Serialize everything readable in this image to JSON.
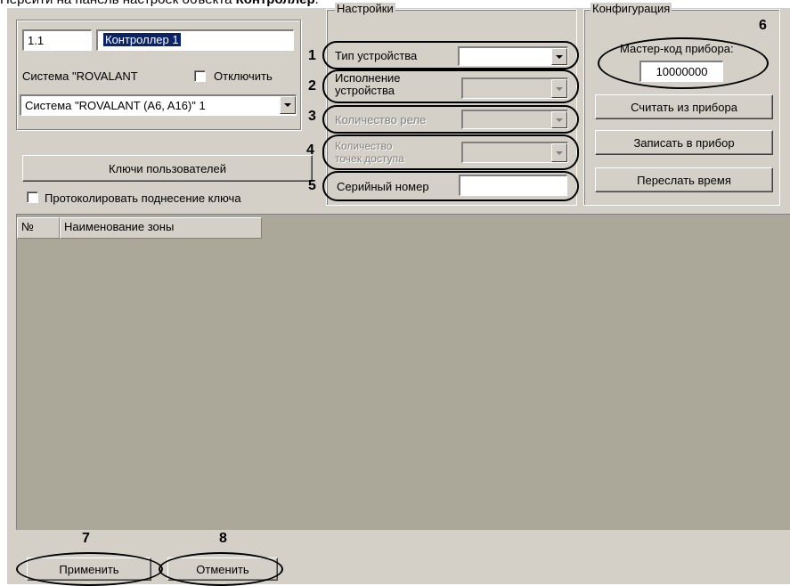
{
  "caption": {
    "prefix": "Перейти на панель настроек объекта ",
    "bold": "Контроллер",
    "suffix": "."
  },
  "object": {
    "id_value": "1.1",
    "name_value": "Контроллер 1",
    "system_label": "Система \"ROVALANT",
    "disable_label": "Отключить",
    "system_select": "Система \"ROVALANT (A6, A16)\" 1"
  },
  "buttons": {
    "user_keys": "Ключи пользователей",
    "read_from_device": "Считать из прибора",
    "write_to_device": "Записать в прибор",
    "send_time": "Переслать время",
    "apply": "Применить",
    "cancel": "Отменить"
  },
  "log_checkbox_label": "Протоколировать поднесение ключа",
  "settings": {
    "title": "Настройки",
    "device_type": "Тип устройства",
    "device_version_line1": "Исполнение",
    "device_version_line2": "устройства",
    "relay_count": "Количество реле",
    "access_points_line1": "Количество",
    "access_points_line2": "точек доступа",
    "serial_number": "Серийный номер"
  },
  "configuration": {
    "title": "Конфигурация",
    "master_code_label": "Мастер-код прибора:",
    "master_code_value": "10000000"
  },
  "table": {
    "columns": [
      "№",
      "Наименование зоны"
    ]
  },
  "callouts": {
    "n1": "1",
    "n2": "2",
    "n3": "3",
    "n4": "4",
    "n5": "5",
    "n6": "6",
    "n7": "7",
    "n8": "8"
  }
}
